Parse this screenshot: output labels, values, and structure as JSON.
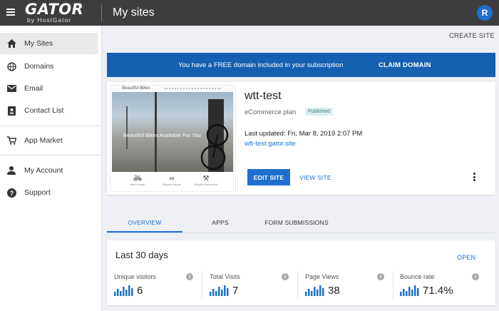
{
  "header": {
    "menu_icon": "hamburger-icon",
    "brand": "GATOR",
    "brand_sub": "by HostGator",
    "page_title": "My sites",
    "avatar_initial": "R"
  },
  "sidebar": {
    "items": [
      {
        "label": "My Sites",
        "icon": "home-icon",
        "active": true
      },
      {
        "label": "Domains",
        "icon": "globe-icon"
      },
      {
        "label": "Email",
        "icon": "mail-icon"
      },
      {
        "label": "Contact List",
        "icon": "contact-book-icon"
      },
      {
        "label": "App Market",
        "icon": "cart-icon"
      },
      {
        "label": "My Account",
        "icon": "person-icon"
      },
      {
        "label": "Support",
        "icon": "help-icon"
      }
    ]
  },
  "main": {
    "create_site": "CREATE SITE",
    "banner": {
      "message": "You have a FREE domain included in your subscription",
      "claim": "CLAIM DOMAIN"
    },
    "site": {
      "thumbnail": {
        "site_title": "Beautiful Bikes",
        "caption": "Beautiful Bikes Available For You",
        "features": [
          {
            "icon": "bicycle-icon",
            "text": "Bike Lineup"
          },
          {
            "icon": "bicycle-chain-icon",
            "text": "Bicycle Repair"
          },
          {
            "icon": "bike-parts-icon",
            "text": "Bicycle Equipment"
          }
        ]
      },
      "name": "wtt-test",
      "plan": "eCommerce plan",
      "status": "Published",
      "last_updated_label": "Last updated:",
      "last_updated_value": "Fri, Mar 8, 2019 2:07 PM",
      "url": "wtt-test.gator.site",
      "edit": "EDIT SITE",
      "view": "VIEW SITE"
    },
    "tabs": [
      {
        "label": "OVERVIEW",
        "active": true
      },
      {
        "label": "APPS"
      },
      {
        "label": "FORM SUBMISSIONS"
      }
    ],
    "stats": {
      "heading": "Last 30 days",
      "open": "OPEN",
      "metrics": [
        {
          "label": "Unique visitors",
          "value": "6"
        },
        {
          "label": "Total Visits",
          "value": "7"
        },
        {
          "label": "Page Views",
          "value": "38"
        },
        {
          "label": "Bounce rate",
          "value": "71.4%"
        }
      ]
    }
  },
  "colors": {
    "topbar": "#3d3d3d",
    "accent": "#1f6fd1",
    "banner": "#1560b0",
    "background": "#eef0f5"
  }
}
